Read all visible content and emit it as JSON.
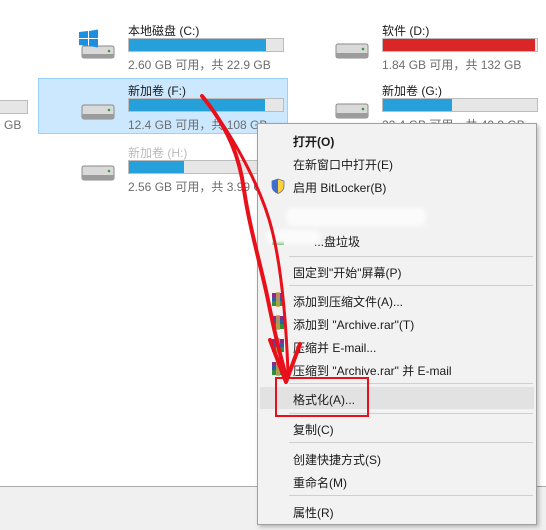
{
  "drives": [
    {
      "name": "本地磁盘 (C:)",
      "free": "2.60 GB 可用，共 22.9 GB",
      "used_fraction": 0.89,
      "icon": "windows-drive-icon",
      "bar_color": "#26a0da"
    },
    {
      "name": "软件 (D:)",
      "free": "1.84 GB 可用，共 132 GB",
      "used_fraction": 0.99,
      "icon": "hard-drive-icon",
      "bar_color": "#da2626"
    },
    {
      "name": "新加卷 (F:)",
      "free": "12.4 GB 可用，共 108 GB",
      "used_fraction": 0.88,
      "icon": "hard-drive-icon",
      "bar_color": "#26a0da",
      "selected": true
    },
    {
      "name": "新加卷 (G:)",
      "free": "22.4 GB 可用，共 40.9 GB",
      "used_fraction": 0.45,
      "icon": "hard-drive-icon",
      "bar_color": "#26a0da"
    },
    {
      "name": "新加卷 (H:)",
      "free": "2.56 GB 可用，共 3.99 GB",
      "used_fraction": 0.36,
      "icon": "hard-drive-icon",
      "bar_color": "#26a0da"
    }
  ],
  "partial_left": {
    "free_fragment": "GB"
  },
  "context_menu": {
    "open": "打开(O)",
    "open_new_window": "在新窗口中打开(E)",
    "bitlocker": "启用 BitLocker(B)",
    "obscured_item": "...",
    "obscured_item_2": "...盘垃圾",
    "pin_start": "固定到\"开始\"屏幕(P)",
    "add_archive": "添加到压缩文件(A)...",
    "add_archive_rar": "添加到 \"Archive.rar\"(T)",
    "compress_email": "压缩并 E-mail...",
    "compress_rar_email": "压缩到 \"Archive.rar\" 并 E-mail",
    "format": "格式化(A)...",
    "copy": "复制(C)",
    "create_shortcut": "创建快捷方式(S)",
    "rename": "重命名(M)",
    "properties": "属性(R)"
  },
  "annotation": {
    "highlight_color": "#e8101a"
  }
}
